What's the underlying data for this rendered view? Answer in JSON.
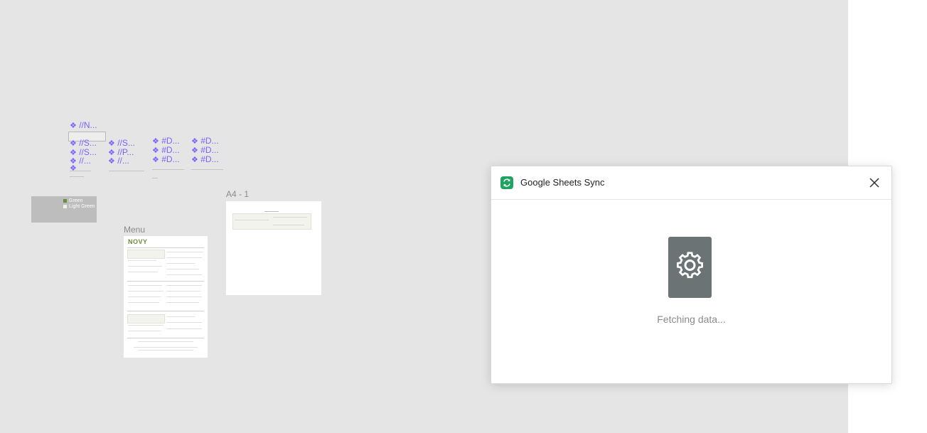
{
  "canvas": {
    "components": [
      {
        "label": "//N..."
      },
      {
        "label": "//S..."
      },
      {
        "label": "//S..."
      },
      {
        "label": "//..."
      },
      {
        "label": "//S..."
      },
      {
        "label": "//P..."
      },
      {
        "label": "//..."
      },
      {
        "label": "#D..."
      },
      {
        "label": "#D..."
      },
      {
        "label": "#D..."
      },
      {
        "label": "#D..."
      },
      {
        "label": "#D..."
      },
      {
        "label": "#D..."
      }
    ],
    "component_glyph": "❖",
    "swatches": [
      {
        "name": "Green",
        "color": "#6b8e3a"
      },
      {
        "name": "Light Green",
        "color": "#eef3e4"
      }
    ],
    "frames": {
      "menu": {
        "label": "Menu",
        "logo": "NOVY"
      },
      "a4": {
        "label": "A4 - 1"
      }
    }
  },
  "dialog": {
    "title": "Google Sheets Sync",
    "status": "Fetching data...",
    "icon_color": "#1ea362",
    "loader_color": "#6b7374"
  }
}
